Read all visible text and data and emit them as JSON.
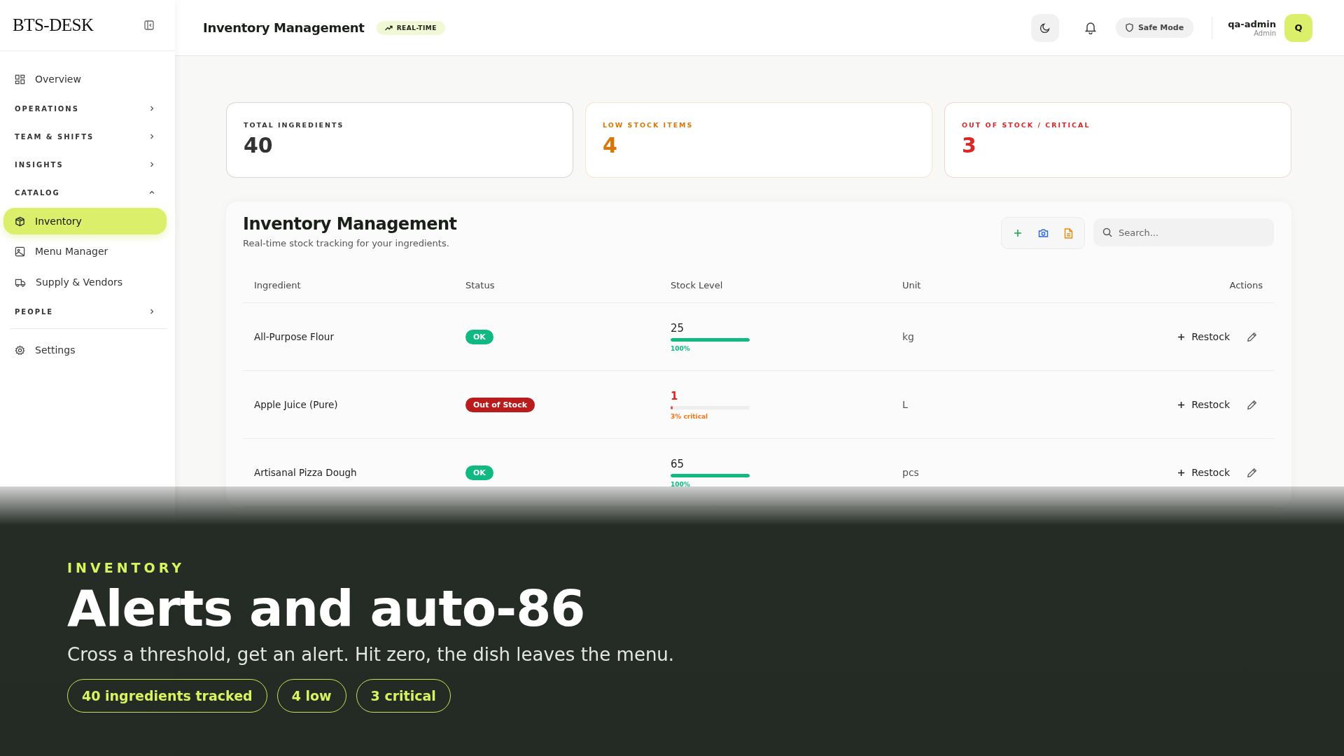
{
  "sidebar": {
    "logo": "BTS-DESK",
    "items": [
      {
        "kind": "link",
        "label": "Overview",
        "selected": false
      },
      {
        "kind": "section",
        "label": "OPERATIONS",
        "expanded": false
      },
      {
        "kind": "section",
        "label": "TEAM & SHIFTS",
        "expanded": false
      },
      {
        "kind": "section",
        "label": "INSIGHTS",
        "expanded": false
      },
      {
        "kind": "section",
        "label": "CATALOG",
        "expanded": true
      },
      {
        "kind": "link",
        "label": "Inventory",
        "selected": true
      },
      {
        "kind": "link",
        "label": "Menu Manager",
        "selected": false
      },
      {
        "kind": "link",
        "label": "Supply & Vendors",
        "selected": false
      },
      {
        "kind": "section",
        "label": "PEOPLE",
        "expanded": false
      },
      {
        "kind": "divider"
      },
      {
        "kind": "link",
        "label": "Settings",
        "selected": false
      }
    ]
  },
  "topbar": {
    "title": "Inventory Management",
    "badge": "REAL-TIME",
    "safe_mode": "Safe Mode",
    "user": {
      "name": "qa-admin",
      "role": "Admin",
      "initial": "Q"
    }
  },
  "stats": [
    {
      "label": "TOTAL INGREDIENTS",
      "value": "40",
      "color": "#333333"
    },
    {
      "label": "LOW STOCK ITEMS",
      "value": "4",
      "color": "#d97706"
    },
    {
      "label": "OUT OF STOCK / CRITICAL",
      "value": "3",
      "color": "#dc2626"
    }
  ],
  "panel": {
    "title": "Inventory Management",
    "subtitle": "Real-time stock tracking for your ingredients.",
    "search": {
      "placeholder": "Search..."
    },
    "table": {
      "columns": [
        "Ingredient",
        "Status",
        "Stock Level",
        "Unit",
        "Actions"
      ],
      "rows": [
        {
          "ingredient": "All-Purpose Flour",
          "status": "OK",
          "color": "#10b981",
          "critical": false,
          "quantity": "25",
          "level": 1,
          "level_label": "100%",
          "unit": "kg",
          "action": "Restock"
        },
        {
          "ingredient": "Apple Juice (Pure)",
          "status": "Out of Stock",
          "color": "#b91c1c",
          "critical": true,
          "quantity": "1",
          "level": 0.03,
          "level_label": "3% critical",
          "unit": "L",
          "action": "Restock"
        },
        {
          "ingredient": "Artisanal Pizza Dough",
          "status": "OK",
          "color": "#10b981",
          "critical": false,
          "quantity": "65",
          "level": 1,
          "level_label": "100%",
          "unit": "pcs",
          "action": "Restock"
        }
      ]
    }
  },
  "overlay": {
    "eyebrow": "INVENTORY",
    "headline": "Alerts and auto-86",
    "subtitle": "Cross a threshold, get an alert. Hit zero, the dish leaves the menu.",
    "pills": [
      "40 ingredients tracked",
      "4 low",
      "3 critical"
    ]
  }
}
